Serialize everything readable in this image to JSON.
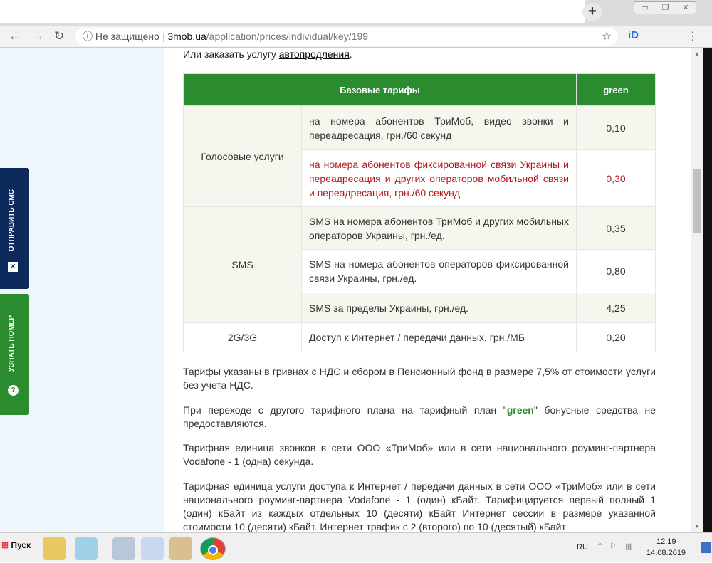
{
  "browser": {
    "new_tab": "+",
    "security": "Не защищено",
    "url_domain": "3mob.ua",
    "url_path": "/application/prices/individual/key/199"
  },
  "side_buttons": {
    "send_sms": "ОТПРАВИТЬ СМС",
    "find_number": "УЗНАТЬ НОМЕР",
    "send_sms_color": "#0d2a5c",
    "find_number_color": "#2a8c2e"
  },
  "page": {
    "intro_text": "Или заказать услугу ",
    "intro_link": "автопродления",
    "intro_end": ".",
    "table": {
      "headers": [
        "Базовые тарифы",
        "green"
      ],
      "groups": [
        {
          "category": "Голосовые услуги",
          "rows": [
            {
              "desc": "на номера абонентов ТриМоб, видео звонки и переадресация, грн./60 секунд",
              "value": "0,10"
            },
            {
              "desc": "на номера абонентов фиксированной связи Украины и переадресация и других операторов мобильной связи и переадресация, грн./60 секунд",
              "value": "0,30"
            }
          ]
        },
        {
          "category": "SMS",
          "rows": [
            {
              "desc": "SMS на номера абонентов ТриМоб и других мобильных операторов Украины, грн./ед.",
              "value": "0,35"
            },
            {
              "desc": "SMS на номера абонентов операторов фиксированной связи Украины, грн./ед.",
              "value": "0,80"
            },
            {
              "desc": "SMS за пределы Украины, грн./ед.",
              "value": "4,25"
            }
          ]
        },
        {
          "category": "2G/3G",
          "rows": [
            {
              "desc": "Доступ к Интернет / передачи данных, грн./МБ",
              "value": "0,20"
            }
          ]
        }
      ]
    },
    "p1": "Тарифы указаны в гривнах с НДС и сбором в Пенсионный фонд в размере 7,5% от стоимости услуги без учета НДС.",
    "p2_a": "При переходе с другого тарифного плана на тарифный план \"",
    "p2_b": "green",
    "p2_c": "\" бонусные средства не предоставляются.",
    "p3": "Тарифная единица звонков в сети ООО «ТриМоб» или в сети национального роуминг-партнера Vodafone - 1 (одна) секунда.",
    "p4": "Тарифная единица услуги доступа к Интернет / передачи данных в сети ООО «ТриМоб» или в сети национального роуминг-партнера Vodafone - 1 (один) кБайт. Тарифицируется первый полный 1 (один) кБайт из каждых отдельных 10 (десяти) кБайт Интернет сессии в размере указанной стоимости 10 (десяти) кБайт. Интернет трафик с 2 (второго) по 10 (десятый) кБайт"
  },
  "taskbar": {
    "start": "Пуск",
    "lang": "RU",
    "time": "12:19",
    "date": "14.08.2019"
  }
}
